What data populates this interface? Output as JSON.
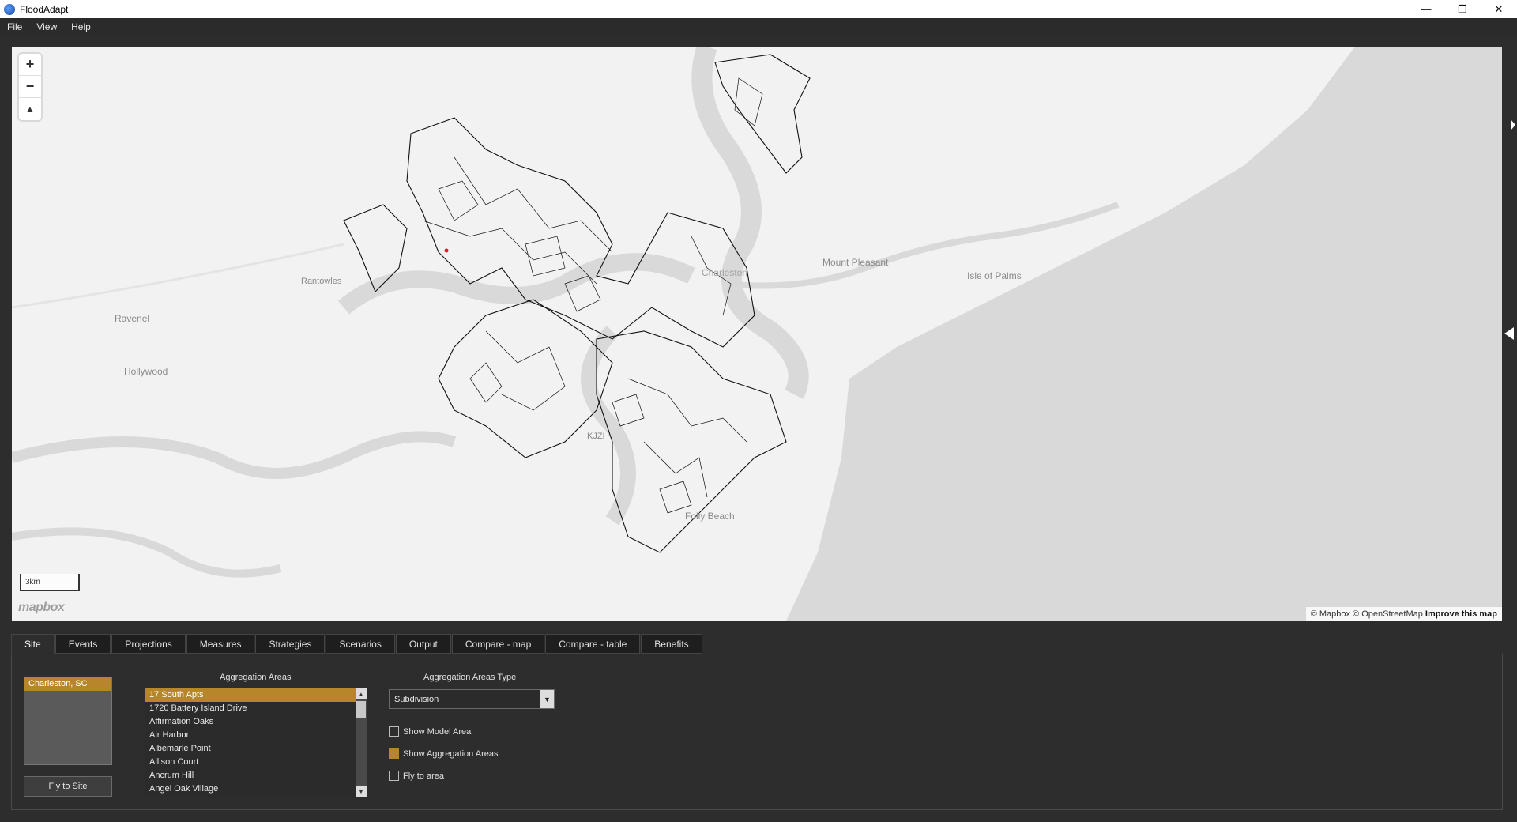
{
  "window": {
    "title": "FloodAdapt",
    "min_label": "—",
    "max_label": "❐",
    "close_label": "✕"
  },
  "menu": [
    "File",
    "View",
    "Help"
  ],
  "map": {
    "zoom_in": "+",
    "zoom_out": "−",
    "compass": "▲",
    "scale_label": "3km",
    "logo_text": "mapbox",
    "attribution": "© Mapbox © OpenStreetMap",
    "improve_link": "Improve this map",
    "places": [
      "Mount Pleasant",
      "Isle of Palms",
      "Rantowles",
      "Ravenel",
      "Hollywood",
      "KJZI",
      "Folly Beach",
      "Charleston"
    ]
  },
  "tabs": [
    "Site",
    "Events",
    "Projections",
    "Measures",
    "Strategies",
    "Scenarios",
    "Output",
    "Compare - map",
    "Compare - table",
    "Benefits"
  ],
  "site": {
    "sites": [
      "Charleston, SC"
    ],
    "fly_button": "Fly to Site",
    "aggregation_title": "Aggregation Areas",
    "aggregation_items": [
      "17 South Apts",
      "1720 Battery Island Drive",
      "Affirmation Oaks",
      "Air Harbor",
      "Albemarle Point",
      "Allison Court",
      "Ancrum Hill",
      "Angel Oak Village"
    ],
    "type_title": "Aggregation Areas Type",
    "type_value": "Subdivision",
    "checks": [
      {
        "label": "Show Model Area",
        "checked": false
      },
      {
        "label": "Show Aggregation Areas",
        "checked": true
      },
      {
        "label": "Fly to area",
        "checked": false
      }
    ]
  },
  "colors": {
    "accent": "#b8862a",
    "water": "#d7d7d7",
    "land": "#f2f2f2"
  }
}
